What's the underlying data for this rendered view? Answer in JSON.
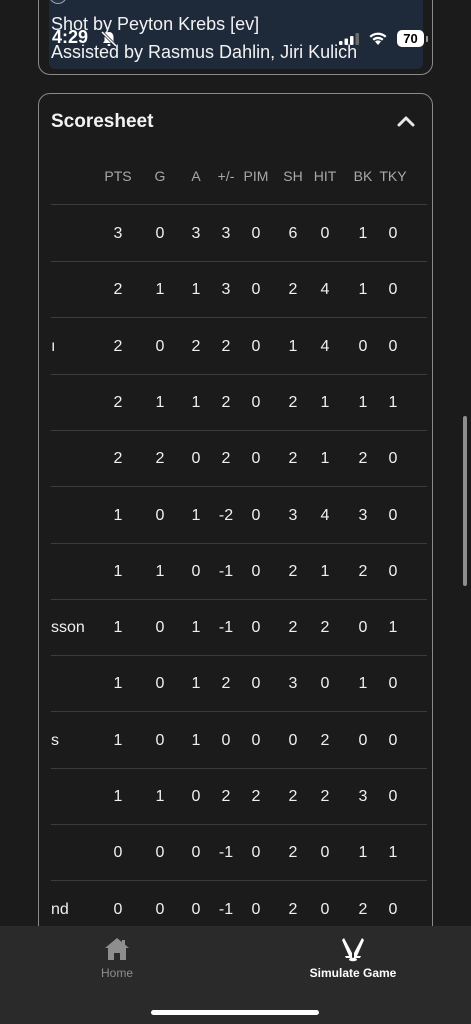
{
  "status_bar": {
    "time": "4:29",
    "battery": "70"
  },
  "goal": {
    "shot_by": "Shot by Peyton Krebs [ev]",
    "assisted_by": "Assisted by Rasmus Dahlin, Jiri Kulich"
  },
  "scoresheet": {
    "title": "Scoresheet",
    "columns": [
      "PTS",
      "G",
      "A",
      "+/-",
      "PIM",
      "SH",
      "HIT",
      "BK",
      "TKY"
    ],
    "rows": [
      {
        "name": "",
        "stats": [
          "3",
          "0",
          "3",
          "3",
          "0",
          "6",
          "0",
          "1",
          "0"
        ]
      },
      {
        "name": "",
        "stats": [
          "2",
          "1",
          "1",
          "3",
          "0",
          "2",
          "4",
          "1",
          "0"
        ]
      },
      {
        "name": "ı",
        "stats": [
          "2",
          "0",
          "2",
          "2",
          "0",
          "1",
          "4",
          "0",
          "0"
        ]
      },
      {
        "name": "",
        "stats": [
          "2",
          "1",
          "1",
          "2",
          "0",
          "2",
          "1",
          "1",
          "1"
        ]
      },
      {
        "name": "",
        "stats": [
          "2",
          "2",
          "0",
          "2",
          "0",
          "2",
          "1",
          "2",
          "0"
        ]
      },
      {
        "name": "",
        "stats": [
          "1",
          "0",
          "1",
          "-2",
          "0",
          "3",
          "4",
          "3",
          "0"
        ]
      },
      {
        "name": "",
        "stats": [
          "1",
          "1",
          "0",
          "-1",
          "0",
          "2",
          "1",
          "2",
          "0"
        ]
      },
      {
        "name": "sson",
        "stats": [
          "1",
          "0",
          "1",
          "-1",
          "0",
          "2",
          "2",
          "0",
          "1"
        ]
      },
      {
        "name": "",
        "stats": [
          "1",
          "0",
          "1",
          "2",
          "0",
          "3",
          "0",
          "1",
          "0"
        ]
      },
      {
        "name": "s",
        "stats": [
          "1",
          "0",
          "1",
          "0",
          "0",
          "0",
          "2",
          "0",
          "0"
        ]
      },
      {
        "name": "",
        "stats": [
          "1",
          "1",
          "0",
          "2",
          "2",
          "2",
          "2",
          "3",
          "0"
        ]
      },
      {
        "name": "",
        "stats": [
          "0",
          "0",
          "0",
          "-1",
          "0",
          "2",
          "0",
          "1",
          "1"
        ]
      },
      {
        "name": "nd",
        "stats": [
          "0",
          "0",
          "0",
          "-1",
          "0",
          "2",
          "0",
          "2",
          "0"
        ]
      }
    ]
  },
  "tabbar": {
    "home_label": "Home",
    "simulate_label": "Simulate Game"
  }
}
